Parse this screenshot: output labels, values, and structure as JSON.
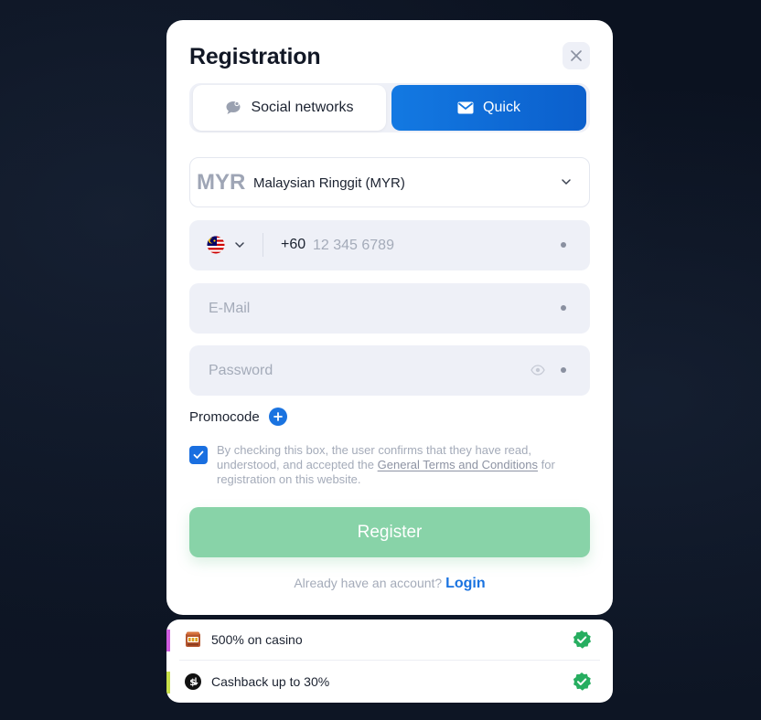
{
  "modal": {
    "title": "Registration",
    "close_icon": "close-icon"
  },
  "tabs": [
    {
      "label": "Social networks",
      "icon": "chat-bubble-icon",
      "active": false
    },
    {
      "label": "Quick",
      "icon": "envelope-icon",
      "active": true
    }
  ],
  "currency": {
    "code": "MYR",
    "name": "Malaysian Ringgit (MYR)"
  },
  "phone": {
    "country_flag": "malaysia-flag-icon",
    "prefix": "+60",
    "placeholder": "12 345 6789"
  },
  "email": {
    "placeholder": "E-Mail"
  },
  "password": {
    "placeholder": "Password"
  },
  "promo": {
    "label": "Promocode"
  },
  "agreement": {
    "checked": true,
    "text_before": "By checking this box, the user confirms that they have read, understood, and accepted the ",
    "link": "General Terms and Conditions",
    "text_after": " for registration on this website."
  },
  "register_button": "Register",
  "login": {
    "prompt": "Already have an account?",
    "link": "Login"
  },
  "bonuses": [
    {
      "text": "500% on casino",
      "icon": "slot-machine-icon",
      "accent": "#d05ce0"
    },
    {
      "text": "Cashback up to 30%",
      "icon": "cashback-coin-icon",
      "accent": "#c8e04a"
    }
  ],
  "colors": {
    "primary": "#1a73e0",
    "register_disabled": "#88d3a8",
    "badge_green": "#27ae60"
  }
}
